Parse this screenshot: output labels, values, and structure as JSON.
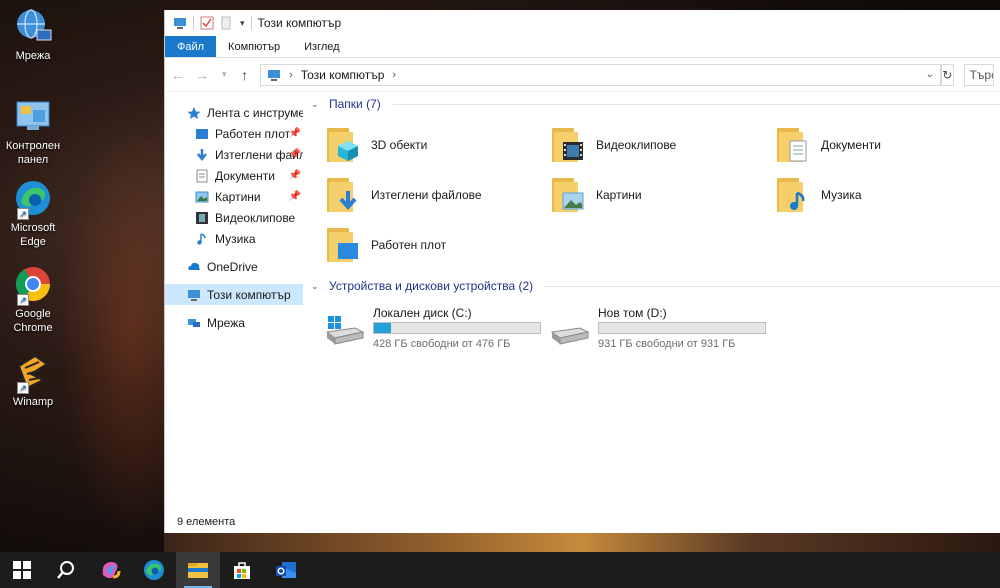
{
  "desktop": {
    "icons": [
      {
        "label": "Мрежа"
      },
      {
        "label": "Контролен панел"
      },
      {
        "label": "Microsoft Edge"
      },
      {
        "label": "Google Chrome"
      },
      {
        "label": "Winamp"
      }
    ]
  },
  "window": {
    "title": "Този компютър",
    "ribbon_tabs": [
      "Файл",
      "Компютър",
      "Изглед"
    ],
    "address": {
      "path_label": "Този компютър",
      "search_placeholder": "Търсе"
    },
    "nav": {
      "quick_access": "Лента с инструменти",
      "pinned": [
        {
          "label": "Работен плот",
          "pinned": true
        },
        {
          "label": "Изтеглени файл",
          "pinned": true
        },
        {
          "label": "Документи",
          "pinned": true
        },
        {
          "label": "Картини",
          "pinned": true
        },
        {
          "label": "Видеоклипове",
          "pinned": false
        },
        {
          "label": "Музика",
          "pinned": false
        }
      ],
      "onedrive": "OneDrive",
      "this_pc": "Този компютър",
      "network": "Мрежа"
    },
    "folders_group": "Папки (7)",
    "folders": [
      {
        "label": "3D обекти",
        "icon": "3d-objects-folder-icon"
      },
      {
        "label": "Видеоклипове",
        "icon": "videos-folder-icon"
      },
      {
        "label": "Документи",
        "icon": "documents-folder-icon"
      },
      {
        "label": "Изтеглени файлове",
        "icon": "downloads-folder-icon"
      },
      {
        "label": "Картини",
        "icon": "pictures-folder-icon"
      },
      {
        "label": "Музика",
        "icon": "music-folder-icon"
      },
      {
        "label": "Работен плот",
        "icon": "desktop-folder-icon"
      }
    ],
    "drives_group": "Устройства и дискови устройства (2)",
    "drives": [
      {
        "name": "Локален диск (C:)",
        "free_text": "428 ГБ свободни от 476 ГБ",
        "used_fraction": 0.1
      },
      {
        "name": "Нов том (D:)",
        "free_text": "931 ГБ свободни от 931 ГБ",
        "used_fraction": 0.0
      }
    ],
    "status": "9 елемента"
  },
  "taskbar": {
    "items": [
      "start-icon",
      "search-icon",
      "copilot-icon",
      "edge-icon",
      "file-explorer-icon",
      "store-icon",
      "outlook-icon"
    ]
  }
}
